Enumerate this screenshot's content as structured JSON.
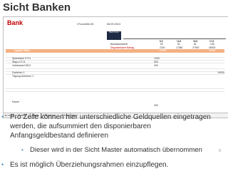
{
  "slide": {
    "title": "Sicht Banken",
    "page_number": "8"
  },
  "sheet": {
    "bank_title": "Bank",
    "id_text": "27vorzeitä-KK",
    "date_text": "08.09.2013",
    "header_box": "Bank\nKonto",
    "columns": [
      "6.8",
      "13.8",
      "16.8",
      "17.8"
    ],
    "rows": [
      {
        "label": "Bankstandwerte",
        "values": [
          "50",
          "61",
          "81",
          "106"
        ]
      },
      {
        "label": "Disponierbarer Betrag",
        "values": [
          "2200",
          "17580",
          "27900",
          "45000"
        ]
      }
    ],
    "orange_label": "Liquide Mittel",
    "orange_value_a": "23000",
    "orange_value_b": "14000",
    "sources": [
      {
        "label": "Sparkasse KT11",
        "value": "1000"
      },
      {
        "label": "Stapo KT11",
        "value": "500"
      },
      {
        "label": "Volksbank KB12",
        "value": "400"
      },
      {
        "label": "",
        "value": ""
      },
      {
        "label": "Darlehen 1",
        "value": ""
      },
      {
        "label": "Tilgung Darlehen 1",
        "value": ""
      },
      {
        "label": "",
        "value": ""
      },
      {
        "label": "Kasse",
        "value": "300"
      }
    ],
    "darlehen_value": "10000",
    "tabs": [
      "Master",
      "Bank",
      "Ausgaben",
      "Einnahmen"
    ]
  },
  "bullets": {
    "b1": "Pro Zeile können hier unterschiedliche Geldquellen eingetragen werden, die aufsummiert den disponierbaren Anfangsgeldbestand definieren",
    "b2": "Dieser wird in der Sicht Master automatisch übernommen",
    "b3": "Es ist möglich Überziehungsrahmen einzupflegen."
  },
  "colors": {
    "bank_title": "#c00000",
    "header_box": "#1f2a44",
    "orange_bar": "#f4b183",
    "text": "#333333"
  }
}
